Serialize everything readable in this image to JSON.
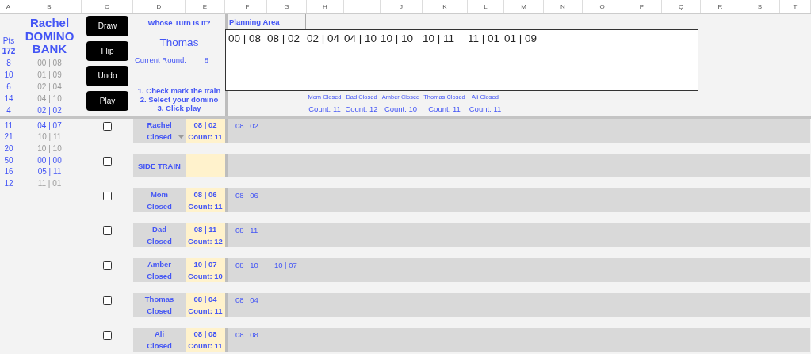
{
  "columns": [
    "A",
    "B",
    "C",
    "D",
    "E",
    "F",
    "G",
    "H",
    "I",
    "J",
    "K",
    "L",
    "M",
    "N",
    "O",
    "P",
    "Q",
    "R",
    "S",
    "T"
  ],
  "bank": {
    "title": [
      "Rachel",
      "DOMINO",
      "BANK"
    ],
    "pts_label": "Pts",
    "total": "172",
    "upper": [
      {
        "pts": "8",
        "tile": "00 | 08",
        "used": true
      },
      {
        "pts": "10",
        "tile": "01 | 09",
        "used": true
      },
      {
        "pts": "6",
        "tile": "02 | 04",
        "used": true
      },
      {
        "pts": "14",
        "tile": "04 | 10",
        "used": true
      },
      {
        "pts": "4",
        "tile": "02 | 02",
        "used": false
      }
    ],
    "lower": [
      {
        "pts": "11",
        "tile": "04 | 07",
        "used": false
      },
      {
        "pts": "21",
        "tile": "10 | 11",
        "used": true
      },
      {
        "pts": "20",
        "tile": "10 | 10",
        "used": true
      },
      {
        "pts": "50",
        "tile": "00 | 00",
        "used": false
      },
      {
        "pts": "16",
        "tile": "05 | 11",
        "used": false
      },
      {
        "pts": "12",
        "tile": "11 | 01",
        "used": true
      }
    ]
  },
  "buttons": [
    "Draw",
    "Flip",
    "Undo",
    "Play"
  ],
  "turn": {
    "heading": "Whose Turn Is It?",
    "player": "Thomas",
    "round_label": "Current Round:",
    "round": "8",
    "instructions": [
      "1. Check mark the train",
      "2. Select your domino",
      "3. Click play"
    ]
  },
  "planning": {
    "label": "Planning Area",
    "tiles": [
      "00 | 08",
      "08 | 02",
      "02 | 04",
      "04 | 10",
      "10 | 10",
      "10 | 11",
      "11 | 01",
      "01 | 09"
    ],
    "summary": [
      {
        "status": "Mom Closed",
        "count": "Count: 11"
      },
      {
        "status": "Dad Closed",
        "count": "Count: 12"
      },
      {
        "status": "Amber Closed",
        "count": "Count: 10"
      },
      {
        "status": "Thomas Closed",
        "count": "Count: 11"
      },
      {
        "status": "Ali Closed",
        "count": "Count: 11"
      }
    ]
  },
  "trains": [
    {
      "kind": "player",
      "name": "Rachel",
      "status": "Closed",
      "dropdown": true,
      "head": "08 | 02",
      "count": "Count: 11",
      "checked": false,
      "plays": [
        "08 | 02"
      ]
    },
    {
      "kind": "side",
      "name": "SIDE TRAIN",
      "checked": false
    },
    {
      "kind": "player",
      "name": "Mom",
      "status": "Closed",
      "dropdown": false,
      "head": "08 | 06",
      "count": "Count: 11",
      "checked": false,
      "plays": [
        "08 | 06"
      ]
    },
    {
      "kind": "player",
      "name": "Dad",
      "status": "Closed",
      "dropdown": false,
      "head": "08 | 11",
      "count": "Count: 12",
      "checked": false,
      "plays": [
        "08 | 11"
      ]
    },
    {
      "kind": "player",
      "name": "Amber",
      "status": "Closed",
      "dropdown": false,
      "head": "10 | 07",
      "count": "Count: 10",
      "checked": false,
      "plays": [
        "08 | 10",
        "10 | 07"
      ]
    },
    {
      "kind": "player",
      "name": "Thomas",
      "status": "Closed",
      "dropdown": false,
      "head": "08 | 04",
      "count": "Count: 11",
      "checked": false,
      "plays": [
        "08 | 04"
      ]
    },
    {
      "kind": "player",
      "name": "Ali",
      "status": "Closed",
      "dropdown": false,
      "head": "08 | 08",
      "count": "Count: 11",
      "checked": false,
      "plays": [
        "08 | 08"
      ]
    }
  ]
}
